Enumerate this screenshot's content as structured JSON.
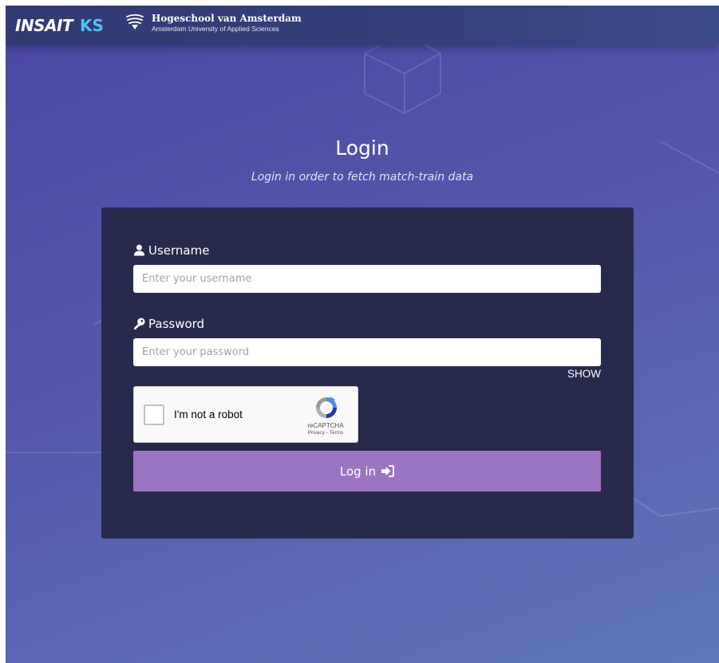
{
  "header": {
    "brand_main": "INSAIT",
    "brand_suffix": "KS",
    "partner_name": "Hogeschool van Amsterdam",
    "partner_subtitle": "Amsterdam University of Applied Sciences"
  },
  "page": {
    "title": "Login",
    "subtitle": "Login in order to fetch match-train data"
  },
  "form": {
    "username_label": "Username",
    "username_placeholder": "Enter your username",
    "username_value": "",
    "password_label": "Password",
    "password_placeholder": "Enter your password",
    "password_value": "",
    "show_label": "SHOW",
    "captcha": {
      "label": "I'm not a robot",
      "brand": "reCAPTCHA",
      "privacy": "Privacy",
      "separator": " - ",
      "terms": "Terms"
    },
    "submit_label": "Log in"
  },
  "colors": {
    "accent_button": "#9b75c2",
    "card_bg": "#272a4c",
    "brand_ks": "#4dc3f0"
  }
}
